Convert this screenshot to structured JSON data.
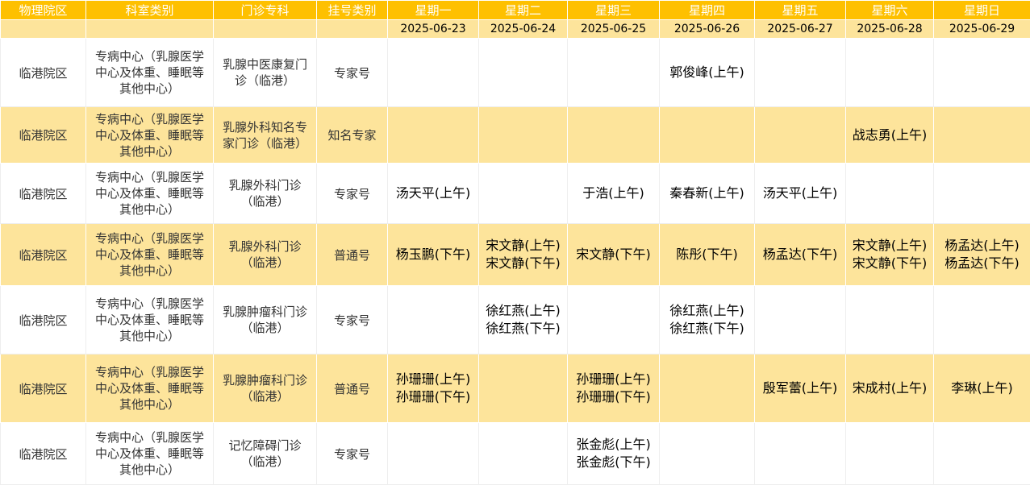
{
  "headers": {
    "campus": "物理院区",
    "dept": "科室类别",
    "spec": "门诊专科",
    "regtype": "挂号类别",
    "days": [
      "星期一",
      "星期二",
      "星期三",
      "星期四",
      "星期五",
      "星期六",
      "星期日"
    ]
  },
  "dates": [
    "2025-06-23",
    "2025-06-24",
    "2025-06-25",
    "2025-06-26",
    "2025-06-27",
    "2025-06-28",
    "2025-06-29"
  ],
  "rows": [
    {
      "campus": "临港院区",
      "dept": "专病中心（乳腺医学中心及体重、睡眠等其他中心）",
      "spec": "乳腺中医康复门诊（临港）",
      "regtype": "专家号",
      "schedule": [
        [],
        [],
        [],
        [
          "郭俊峰(上午)"
        ],
        [],
        [],
        []
      ]
    },
    {
      "campus": "临港院区",
      "dept": "专病中心（乳腺医学中心及体重、睡眠等其他中心）",
      "spec": "乳腺外科知名专家门诊（临港）",
      "regtype": "知名专家",
      "schedule": [
        [],
        [],
        [],
        [],
        [],
        [
          "战志勇(上午)"
        ],
        []
      ]
    },
    {
      "campus": "临港院区",
      "dept": "专病中心（乳腺医学中心及体重、睡眠等其他中心）",
      "spec": "乳腺外科门诊（临港）",
      "regtype": "专家号",
      "schedule": [
        [
          "汤天平(上午)"
        ],
        [],
        [
          "于浩(上午)"
        ],
        [
          "秦春新(上午)"
        ],
        [
          "汤天平(上午)"
        ],
        [],
        []
      ]
    },
    {
      "campus": "临港院区",
      "dept": "专病中心（乳腺医学中心及体重、睡眠等其他中心）",
      "spec": "乳腺外科门诊（临港）",
      "regtype": "普通号",
      "schedule": [
        [
          "杨玉鹏(下午)"
        ],
        [
          "宋文静(上午)",
          "宋文静(下午)"
        ],
        [
          "宋文静(下午)"
        ],
        [
          "陈彤(下午)"
        ],
        [
          "杨孟达(下午)"
        ],
        [
          "宋文静(上午)",
          "宋文静(下午)"
        ],
        [
          "杨孟达(上午)",
          "杨孟达(下午)"
        ]
      ]
    },
    {
      "campus": "临港院区",
      "dept": "专病中心（乳腺医学中心及体重、睡眠等其他中心）",
      "spec": "乳腺肿瘤科门诊（临港）",
      "regtype": "专家号",
      "schedule": [
        [],
        [
          "徐红燕(上午)",
          "徐红燕(下午)"
        ],
        [],
        [
          "徐红燕(上午)",
          "徐红燕(下午)"
        ],
        [],
        [],
        []
      ]
    },
    {
      "campus": "临港院区",
      "dept": "专病中心（乳腺医学中心及体重、睡眠等其他中心）",
      "spec": "乳腺肿瘤科门诊（临港）",
      "regtype": "普通号",
      "schedule": [
        [
          "孙珊珊(上午)",
          "孙珊珊(下午)"
        ],
        [],
        [
          "孙珊珊(上午)",
          "孙珊珊(下午)"
        ],
        [],
        [
          "殷军蕾(上午)"
        ],
        [
          "宋成村(上午)"
        ],
        [
          "李琳(上午)"
        ]
      ]
    },
    {
      "campus": "临港院区",
      "dept": "专病中心（乳腺医学中心及体重、睡眠等其他中心）",
      "spec": "记忆障碍门诊（临港）",
      "regtype": "专家号",
      "schedule": [
        [],
        [],
        [
          "张金彪(上午)",
          "张金彪(下午)"
        ],
        [],
        [],
        [],
        []
      ]
    }
  ]
}
